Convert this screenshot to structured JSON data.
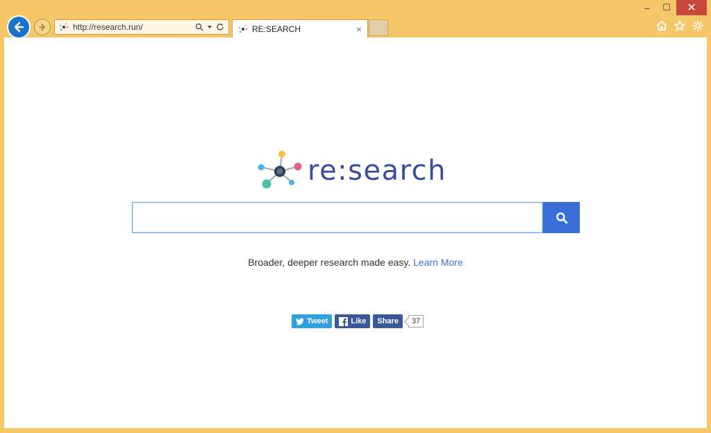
{
  "window": {
    "minimize": "–",
    "maximize": "☐",
    "close": "✕"
  },
  "address_bar": {
    "url": "http://research.run/"
  },
  "tab": {
    "title": "RE:SEARCH",
    "close": "×"
  },
  "logo": {
    "text": "re:search"
  },
  "search": {
    "value": "",
    "placeholder": ""
  },
  "tagline": {
    "text": "Broader, deeper research made easy.",
    "link": "Learn More"
  },
  "social": {
    "tweet": "Tweet",
    "like": "Like",
    "share": "Share",
    "count": "37"
  },
  "colors": {
    "chrome": "#f6c768",
    "accent": "#3b6fd8",
    "logo_text": "#3a4a9e",
    "twitter": "#2f9fe0",
    "facebook": "#3b5998"
  }
}
